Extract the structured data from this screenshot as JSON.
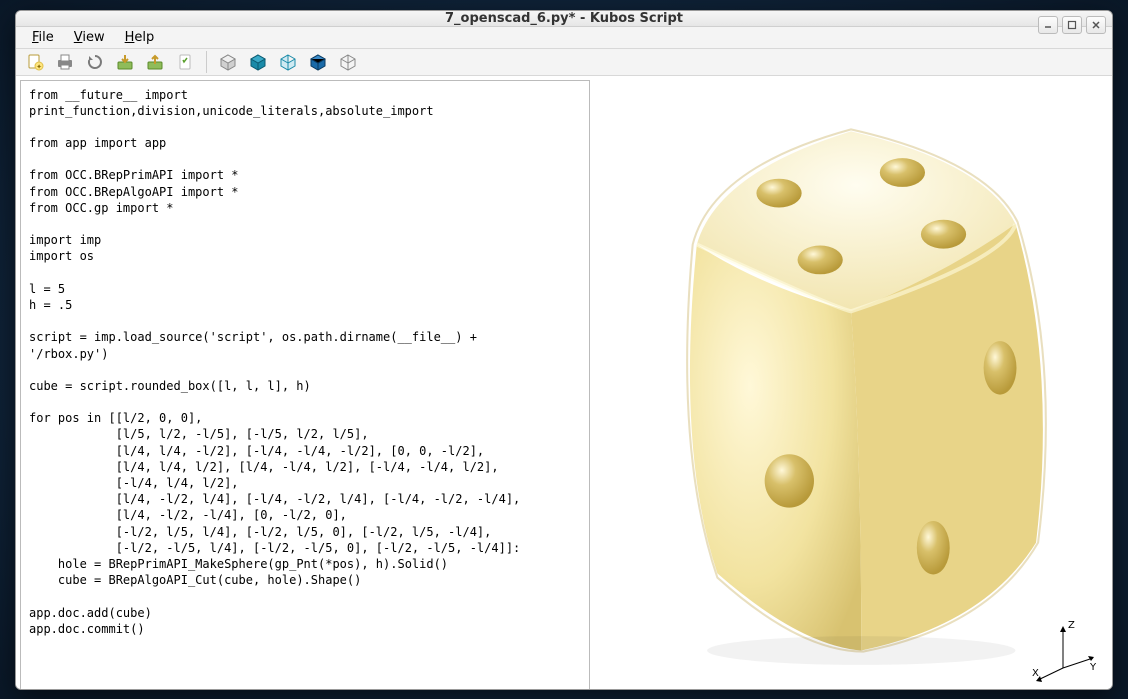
{
  "window": {
    "title": "7_openscad_6.py* - Kubos Script"
  },
  "menu": {
    "file": "File",
    "view": "View",
    "help": "Help"
  },
  "toolbar": {
    "new": "new-file-icon",
    "print": "print-icon",
    "reload": "reload-icon",
    "import": "import-icon",
    "export": "export-icon",
    "page": "page-icon",
    "cube_shaded": "cube-shaded-icon",
    "cube_solid": "cube-solid-icon",
    "cube_wire1": "cube-wireframe-icon",
    "cube_iso": "cube-iso-icon",
    "cube_wire2": "cube-wire-light-icon"
  },
  "code": "from __future__ import\nprint_function,division,unicode_literals,absolute_import\n\nfrom app import app\n\nfrom OCC.BRepPrimAPI import *\nfrom OCC.BRepAlgoAPI import *\nfrom OCC.gp import *\n\nimport imp\nimport os\n\nl = 5\nh = .5\n\nscript = imp.load_source('script', os.path.dirname(__file__) +\n'/rbox.py')\n\ncube = script.rounded_box([l, l, l], h)\n\nfor pos in [[l/2, 0, 0],\n            [l/5, l/2, -l/5], [-l/5, l/2, l/5],\n            [l/4, l/4, -l/2], [-l/4, -l/4, -l/2], [0, 0, -l/2],\n            [l/4, l/4, l/2], [l/4, -l/4, l/2], [-l/4, -l/4, l/2],\n            [-l/4, l/4, l/2],\n            [l/4, -l/2, l/4], [-l/4, -l/2, l/4], [-l/4, -l/2, -l/4],\n            [l/4, -l/2, -l/4], [0, -l/2, 0],\n            [-l/2, l/5, l/4], [-l/2, l/5, 0], [-l/2, l/5, -l/4],\n            [-l/2, -l/5, l/4], [-l/2, -l/5, 0], [-l/2, -l/5, -l/4]]:\n    hole = BRepPrimAPI_MakeSphere(gp_Pnt(*pos), h).Solid()\n    cube = BRepAlgoAPI_Cut(cube, hole).Shape()\n\napp.doc.add(cube)\napp.doc.commit()",
  "triad": {
    "x": "X",
    "y": "Y",
    "z": "Z"
  }
}
